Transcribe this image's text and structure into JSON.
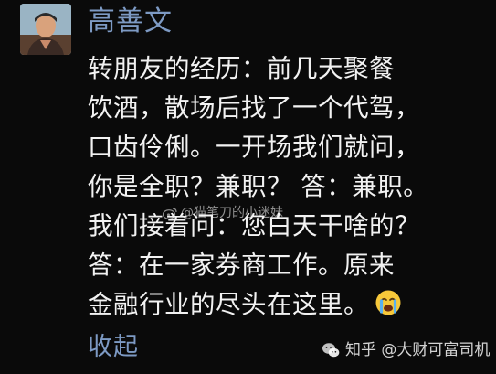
{
  "post": {
    "author": "高善文",
    "lines": [
      "转朋友的经历：前几天聚餐",
      "饮酒，散场后找了一个代驾，",
      "口齿伶俐。一开场我们就问，",
      "你是全职？兼职？ 答：兼职。",
      "我们接着问：您白天干啥的？",
      " 答：在一家券商工作。原来",
      "金融行业的尽头在这里。"
    ],
    "collapse_label": "收起"
  },
  "watermarks": {
    "middle": "@猫笔刀的小迷妹",
    "bottom": "知乎 @大财可富司机"
  },
  "icons": {
    "emoji": "crying-face-icon",
    "weibo": "weibo-icon",
    "wechat": "wechat-icon"
  },
  "colors": {
    "background": "#0a0a0a",
    "accent": "#7d9ac4",
    "text": "#f2f2f2"
  }
}
